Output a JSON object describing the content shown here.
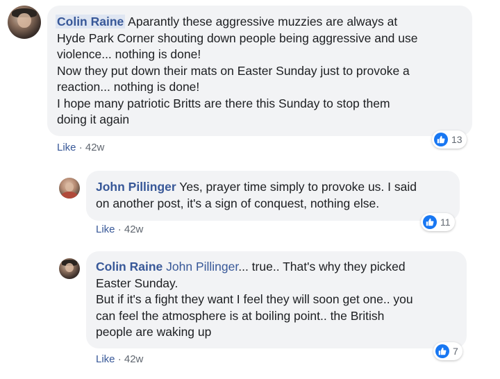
{
  "comments": [
    {
      "author": "Colin Raine",
      "mention": "",
      "text": " Aparantly these aggressive muzzies are always at\nHyde Park Corner shouting down people being aggressive and use\nviolence... nothing is done!\nNow they put down their mats on Easter Sunday just to provoke a\nreaction... nothing is done!\nI hope many patriotic Britts are there this Sunday to stop them\ndoing it again",
      "like_label": "Like",
      "sep": " · ",
      "time": "42w",
      "reactions": "13"
    },
    {
      "author": "John Pillinger",
      "mention": "",
      "text": " Yes, prayer time simply to provoke us. I said\non another post, it's a sign of conquest, nothing else.",
      "like_label": "Like",
      "sep": " · ",
      "time": "42w",
      "reactions": "11"
    },
    {
      "author": "Colin Raine",
      "mention": " John Pillinger",
      "text": "... true.. That's why they picked\nEaster Sunday.\nBut if it's a fight they want I feel they will soon get one.. you\ncan feel the atmosphere is at boiling point.. the British\npeople are waking up",
      "like_label": "Like",
      "sep": " · ",
      "time": "42w",
      "reactions": "7"
    }
  ],
  "colors": {
    "link": "#385898",
    "bubble": "#f2f3f5",
    "like_blue": "#1877f2"
  },
  "icons": [
    "avatar",
    "thumbs-up-icon"
  ]
}
